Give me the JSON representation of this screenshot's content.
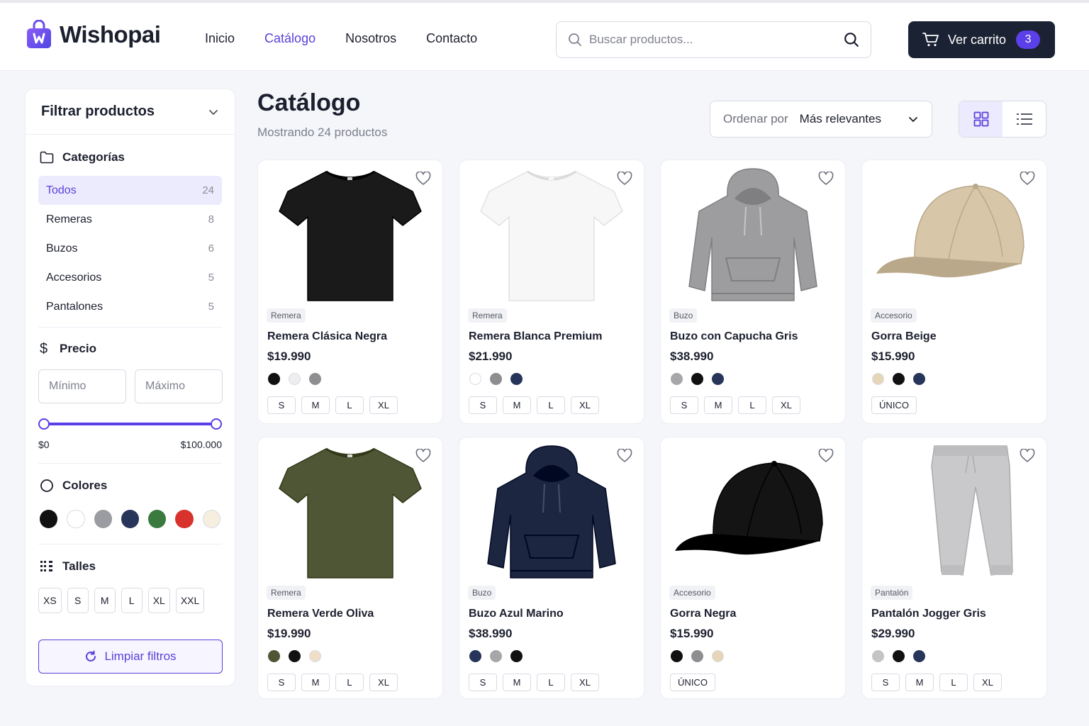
{
  "brand": {
    "name": "Wishopai",
    "accent": "#5b3fe8",
    "dark": "#1b2233"
  },
  "nav": [
    {
      "label": "Inicio",
      "active": false
    },
    {
      "label": "Catálogo",
      "active": true
    },
    {
      "label": "Nosotros",
      "active": false
    },
    {
      "label": "Contacto",
      "active": false
    }
  ],
  "search": {
    "placeholder": "Buscar productos..."
  },
  "cart": {
    "label": "Ver carrito",
    "count": "3"
  },
  "sidebar": {
    "title": "Filtrar productos",
    "categories_title": "Categorías",
    "categories": [
      {
        "label": "Todos",
        "count": "24",
        "active": true
      },
      {
        "label": "Remeras",
        "count": "8",
        "active": false
      },
      {
        "label": "Buzos",
        "count": "6",
        "active": false
      },
      {
        "label": "Accesorios",
        "count": "5",
        "active": false
      },
      {
        "label": "Pantalones",
        "count": "5",
        "active": false
      }
    ],
    "price_title": "Precio",
    "price_min_placeholder": "Mínimo",
    "price_max_placeholder": "Máximo",
    "price_min_label": "$0",
    "price_max_label": "$100.000",
    "colors_title": "Colores",
    "colors": [
      "#111111",
      "#ffffff",
      "#9b9ca1",
      "#27355a",
      "#3b7a3f",
      "#d8322c",
      "#f6efdf"
    ],
    "sizes_title": "Talles",
    "sizes": [
      "XS",
      "S",
      "M",
      "L",
      "XL",
      "XXL"
    ],
    "clear_label": "Limpiar filtros"
  },
  "main": {
    "title": "Catálogo",
    "subtitle": "Mostrando 24 productos",
    "sort_label": "Ordenar por",
    "sort_value": "Más relevantes"
  },
  "products": [
    {
      "category": "Remera",
      "name": "Remera Clásica Negra",
      "price": "$19.990",
      "image": "tshirt",
      "color": "#1a1a1a",
      "swatches": [
        "#111111",
        "#eeeeee",
        "#8e8e90"
      ],
      "sizes": [
        "S",
        "M",
        "L",
        "XL"
      ]
    },
    {
      "category": "Remera",
      "name": "Remera Blanca Premium",
      "price": "$21.990",
      "image": "tshirt",
      "color": "#f7f7f7",
      "swatches": [
        "#ffffff",
        "#8e8e90",
        "#27355a"
      ],
      "sizes": [
        "S",
        "M",
        "L",
        "XL"
      ]
    },
    {
      "category": "Buzo",
      "name": "Buzo con Capucha Gris",
      "price": "$38.990",
      "image": "hoodie",
      "color": "#9d9d9f",
      "swatches": [
        "#a7a7aa",
        "#111111",
        "#27355a"
      ],
      "sizes": [
        "S",
        "M",
        "L",
        "XL"
      ]
    },
    {
      "category": "Accesorio",
      "name": "Gorra Beige",
      "price": "$15.990",
      "image": "cap",
      "color": "#d7c6a8",
      "swatches": [
        "#e6d6b8",
        "#111111",
        "#27355a"
      ],
      "sizes": [
        "ÚNICO"
      ]
    },
    {
      "category": "Remera",
      "name": "Remera Verde Oliva",
      "price": "$19.990",
      "image": "tshirt",
      "color": "#4f5635",
      "swatches": [
        "#4f5635",
        "#111111",
        "#efdfc9"
      ],
      "sizes": [
        "S",
        "M",
        "L",
        "XL"
      ]
    },
    {
      "category": "Buzo",
      "name": "Buzo Azul Marino",
      "price": "$38.990",
      "image": "hoodie",
      "color": "#1c2640",
      "swatches": [
        "#27355a",
        "#a7a7aa",
        "#111111"
      ],
      "sizes": [
        "S",
        "M",
        "L",
        "XL"
      ]
    },
    {
      "category": "Accesorio",
      "name": "Gorra Negra",
      "price": "$15.990",
      "image": "cap",
      "color": "#141414",
      "swatches": [
        "#111111",
        "#8e8e90",
        "#e6d6b8"
      ],
      "sizes": [
        "ÚNICO"
      ]
    },
    {
      "category": "Pantalón",
      "name": "Pantalón Jogger Gris",
      "price": "$29.990",
      "image": "pants",
      "color": "#c9c9cc",
      "swatches": [
        "#c4c4c7",
        "#111111",
        "#27355a"
      ],
      "sizes": [
        "S",
        "M",
        "L",
        "XL"
      ]
    }
  ]
}
